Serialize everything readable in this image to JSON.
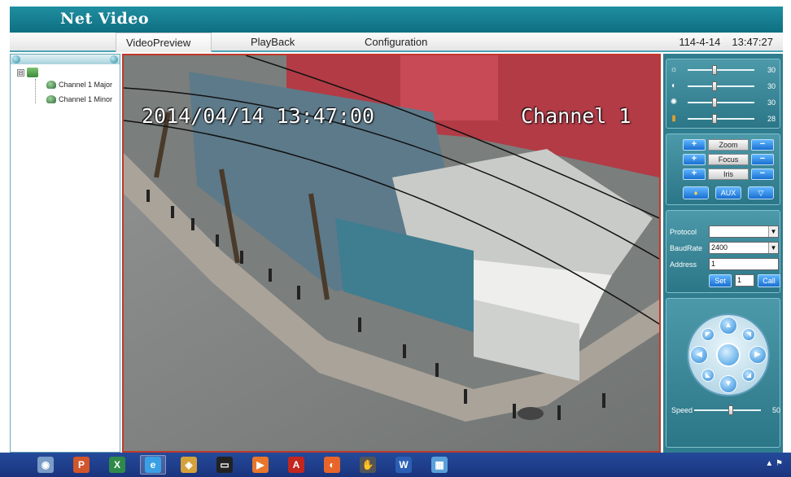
{
  "app": {
    "title": "Net Video"
  },
  "menu": {
    "tabs": [
      {
        "label": "VideoPreview",
        "active": true
      },
      {
        "label": "PlayBack",
        "active": false
      },
      {
        "label": "Configuration",
        "active": false
      }
    ],
    "date": "114-4-14",
    "time": "13:47:27"
  },
  "tree": {
    "toggle": "⊟",
    "channels": [
      "Channel 1 Major",
      "Channel 1 Minor"
    ]
  },
  "video": {
    "timestamp": "2014/04/14 13:47:00",
    "channel_label": "Channel 1"
  },
  "image_controls": [
    {
      "icon": "brightness-icon",
      "glyph": "☼",
      "value": "30",
      "level": 0.4
    },
    {
      "icon": "contrast-icon",
      "glyph": "◐",
      "value": "30",
      "level": 0.4
    },
    {
      "icon": "saturation-icon",
      "glyph": "✺",
      "value": "30",
      "level": 0.4
    },
    {
      "icon": "hue-icon",
      "glyph": "▮",
      "value": "28",
      "level": 0.4
    }
  ],
  "lens": {
    "plus": "+",
    "minus": "−",
    "zoom": "Zoom",
    "focus": "Focus",
    "iris": "Iris",
    "aux": "AUX",
    "light_glyph": "♦",
    "wiper_glyph": "▽"
  },
  "ptz_settings": {
    "protocol_label": "Protocol",
    "protocol_value": "",
    "baudrate_label": "BaudRate",
    "baudrate_value": "2400",
    "address_label": "Address",
    "address_value": "1",
    "set_label": "Set",
    "preset_value": "1",
    "call_label": "Call"
  },
  "ptz": {
    "speed_label": "Speed",
    "speed_value": "50",
    "speed_level": 0.55,
    "arrows": {
      "up": "▲",
      "down": "▼",
      "left": "◀",
      "right": "▶",
      "up_left": "◤",
      "up_right": "◥",
      "down_left": "◣",
      "down_right": "◢"
    }
  },
  "colors": {
    "title_bar": "#1a8294",
    "panel": "#2f7d8e",
    "video_border": "#c0392b",
    "taskbar": "#1f3f8f"
  },
  "taskbar": {
    "items": [
      {
        "name": "chrome-ish-icon",
        "glyph": "◉",
        "color": "#7a9cc6"
      },
      {
        "name": "powerpoint-icon",
        "glyph": "P",
        "color": "#d2552b"
      },
      {
        "name": "excel-icon",
        "glyph": "X",
        "color": "#2f8a4a"
      },
      {
        "name": "internet-explorer-icon",
        "glyph": "e",
        "color": "#3aa0e6",
        "active": true
      },
      {
        "name": "network-icon",
        "glyph": "◈",
        "color": "#d4a23a"
      },
      {
        "name": "terminal-icon",
        "glyph": "▭",
        "color": "#222222"
      },
      {
        "name": "media-player-icon",
        "glyph": "▶",
        "color": "#e8762b"
      },
      {
        "name": "acrobat-icon",
        "glyph": "A",
        "color": "#c3261f"
      },
      {
        "name": "firefox-icon",
        "glyph": "◐",
        "color": "#e8652a"
      },
      {
        "name": "snipping-icon",
        "glyph": "✋",
        "color": "#555555"
      },
      {
        "name": "word-icon",
        "glyph": "W",
        "color": "#2b5fb4"
      },
      {
        "name": "control-panel-icon",
        "glyph": "▦",
        "color": "#5aa0d8"
      }
    ],
    "tray": "▲ ⚑"
  }
}
